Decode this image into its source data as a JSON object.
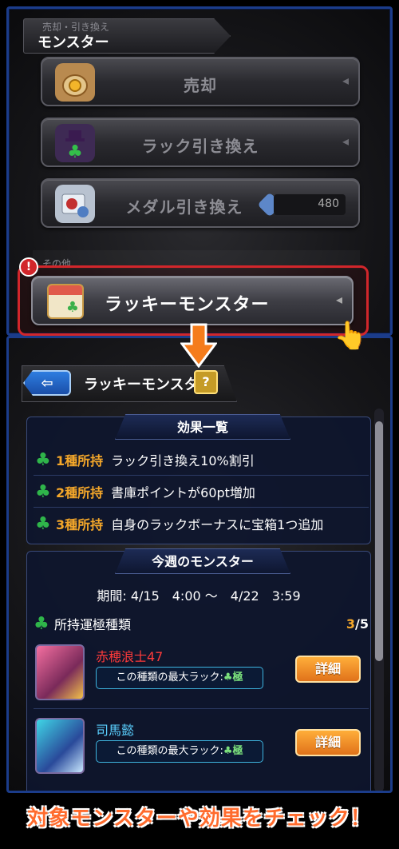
{
  "top_panel": {
    "header_sub": "売却・引き換え",
    "header_title": "モンスター",
    "buttons": [
      {
        "label": "売却",
        "icon": "coin-bag-icon"
      },
      {
        "label": "ラック引き換え",
        "icon": "clover-hat-icon"
      },
      {
        "label": "メダル引き換え",
        "icon": "medal-card-icon",
        "count": "480"
      }
    ],
    "section_other": "その他",
    "lucky_button": {
      "label": "ラッキーモンスター",
      "badge": "!"
    }
  },
  "bottom_panel": {
    "title": "ラッキーモンスター",
    "back_glyph": "⇦",
    "help": "?",
    "effects": {
      "heading": "効果一覧",
      "rows": [
        {
          "tag": "1種所持",
          "text": "ラック引き換え10%割引"
        },
        {
          "tag": "2種所持",
          "text": "書庫ポイントが60pt増加"
        },
        {
          "tag": "3種所持",
          "text": "自身のラックボーナスに宝箱1つ追加"
        }
      ]
    },
    "weekly": {
      "heading": "今週のモンスター",
      "period": "期間: 4/15　4:00 〜　4/22　3:59",
      "owned_label": "所持運極種類",
      "owned_current": "3",
      "owned_total": "/5",
      "monsters": [
        {
          "name": "赤穂浪士47",
          "name_color": "#ff3a3a",
          "luck_label": "この種類の最大ラック:",
          "luck_value": "極",
          "detail": "詳細"
        },
        {
          "name": "司馬懿",
          "name_color": "#5ad0ff",
          "luck_label": "この種類の最大ラック:",
          "luck_value": "極",
          "detail": "詳細"
        }
      ]
    }
  },
  "caption": "対象モンスターや効果をチェック！",
  "colors": {
    "accent_orange": "#f4a72a",
    "frame_blue": "#1b3c8a",
    "highlight_red": "#d2262b",
    "clover_green": "#2fb54a"
  }
}
